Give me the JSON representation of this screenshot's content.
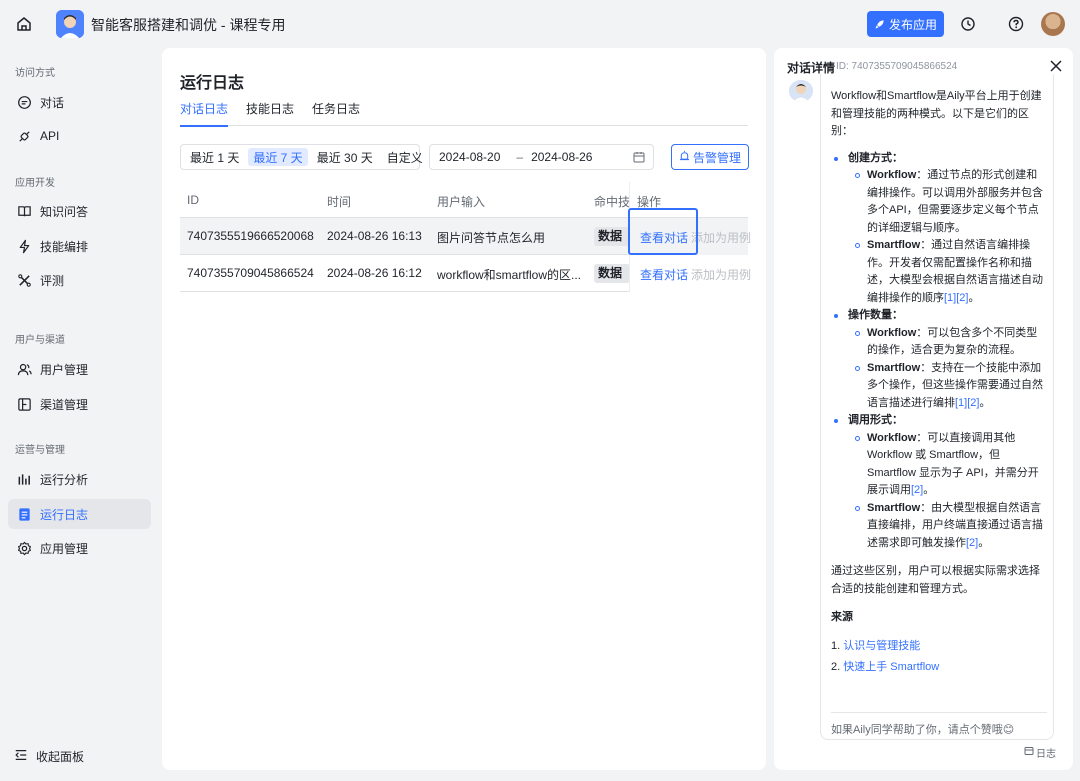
{
  "topbar": {
    "app_title": "智能客服搭建和调优 - 课程专用",
    "publish_label": "发布应用",
    "icons": [
      "home-icon",
      "history-icon",
      "help-icon"
    ]
  },
  "sidebar": {
    "groups": [
      {
        "title": "访问方式",
        "items": [
          {
            "label": "对话",
            "icon": "chat-icon"
          },
          {
            "label": "API",
            "icon": "api-icon"
          }
        ]
      },
      {
        "title": "应用开发",
        "items": [
          {
            "label": "知识问答",
            "icon": "book-icon"
          },
          {
            "label": "技能编排",
            "icon": "bolt-icon"
          },
          {
            "label": "评测",
            "icon": "evaluate-icon"
          }
        ]
      },
      {
        "title": "用户与渠道",
        "items": [
          {
            "label": "用户管理",
            "icon": "users-icon"
          },
          {
            "label": "渠道管理",
            "icon": "channel-icon"
          }
        ]
      },
      {
        "title": "运营与管理",
        "items": [
          {
            "label": "运行分析",
            "icon": "chart-icon"
          },
          {
            "label": "运行日志",
            "icon": "log-icon"
          },
          {
            "label": "应用管理",
            "icon": "gear-icon"
          }
        ]
      }
    ],
    "collapse_label": "收起面板"
  },
  "main": {
    "title": "运行日志",
    "tabs": [
      "对话日志",
      "技能日志",
      "任务日志"
    ],
    "active_tab": "对话日志",
    "ranges": [
      "最近 1 天",
      "最近 7 天",
      "最近 30 天",
      "自定义"
    ],
    "active_range": "最近 7 天",
    "date_start": "2024-08-20",
    "date_sep": "–",
    "date_end": "2024-08-26",
    "alarm_label": "告警管理",
    "columns": [
      "ID",
      "时间",
      "用户输入",
      "命中技能",
      "操作"
    ],
    "rows": [
      {
        "id": "7407355519666520068",
        "time": "2024-08-26 16:13",
        "input": "图片问答节点怎么用",
        "skill": "数据分析",
        "view": "查看对话",
        "add": "添加为用例"
      },
      {
        "id": "7407355709045866524",
        "time": "2024-08-26 16:12",
        "input": "workflow和smartflow的区...",
        "skill": "数据分析",
        "view": "查看对话",
        "add": "添加为用例"
      }
    ]
  },
  "detail": {
    "title": "对话详情",
    "id_label": "ID: 7407355709045866524",
    "intro": "Workflow和Smartflow是Aily平台上用于创建和管理技能的两种模式。以下是它们的区别：",
    "sections": [
      {
        "title": "创建方式：",
        "items": [
          {
            "name": "Workflow",
            "text": "：通过节点的形式创建和编排操作。可以调用外部服务并包含多个API，但需要逐步定义每个节点的详细逻辑与顺序。",
            "refs": ""
          },
          {
            "name": "Smartflow",
            "text": "：通过自然语言编排操作。开发者仅需配置操作名称和描述，大模型会根据自然语言描述自动编排操作的顺序",
            "refs": "[1][2]"
          }
        ]
      },
      {
        "title": "操作数量：",
        "items": [
          {
            "name": "Workflow",
            "text": "：可以包含多个不同类型的操作，适合更为复杂的流程。",
            "refs": ""
          },
          {
            "name": "Smartflow",
            "text": "：支持在一个技能中添加多个操作，但这些操作需要通过自然语言描述进行编排",
            "refs": "[1][2]"
          }
        ]
      },
      {
        "title": "调用形式：",
        "items": [
          {
            "name": "Workflow",
            "text": "：可以直接调用其他 Workflow 或 Smartflow，但 Smartflow 显示为子 API，并需分开展示调用",
            "refs": "[2]"
          },
          {
            "name": "Smartflow",
            "text": "：由大模型根据自然语言直接编排，用户终端直接通过语言描述需求即可触发操作",
            "refs": "[2]"
          }
        ]
      }
    ],
    "conclusion": "通过这些区别，用户可以根据实际需求选择合适的技能创建和管理方式。",
    "sources_title": "来源",
    "sources": [
      {
        "num": "1.",
        "label": "认识与管理技能"
      },
      {
        "num": "2.",
        "label": "快速上手 Smartflow"
      }
    ],
    "feedback": "如果Aily同学帮助了你，请点个赞哦😊",
    "log_label": "日志"
  },
  "colors": {
    "accent": "#3370ff",
    "background": "#f2f3f5",
    "panel": "#ffffff"
  }
}
